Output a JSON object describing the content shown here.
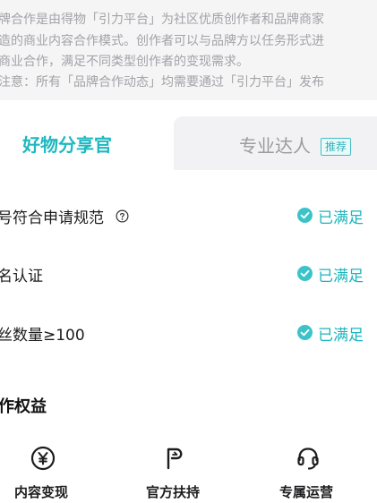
{
  "intro": {
    "line1": "牌合作是由得物「引力平台」为社区优质创作者和品牌商家",
    "line2": "造的商业内容合作模式。创作者可以与品牌方以任务形式进",
    "line3": "商业合作，满足不同类型创作者的变现需求。",
    "line4": "注意：所有「品牌合作动态」均需要通过「引力平台」发布"
  },
  "tabs": {
    "active": "好物分享官",
    "inactive": "专业达人",
    "inactive_badge": "推荐"
  },
  "requirements": [
    {
      "label": "号符合申请规范",
      "has_help": true,
      "status": "已满足"
    },
    {
      "label": "名认证",
      "has_help": false,
      "status": "已满足"
    },
    {
      "label": "丝数量≥100",
      "has_help": false,
      "status": "已满足"
    }
  ],
  "benefits_title": "作权益",
  "benefits": [
    {
      "label": "内容变现",
      "icon": "yen-circle-icon"
    },
    {
      "label": "官方扶持",
      "icon": "support-p-icon"
    },
    {
      "label": "专属运营",
      "icon": "headset-icon"
    }
  ],
  "colors": {
    "accent": "#1fb8c0",
    "check": "#3cc3ca",
    "intro_bg": "#f5f5f6",
    "inactive_tab_bg": "#f2f2f4"
  }
}
